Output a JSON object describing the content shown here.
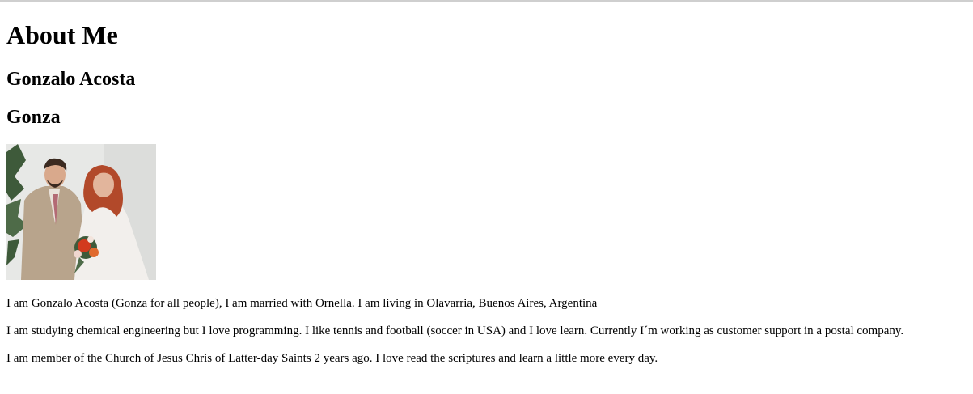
{
  "page": {
    "heading": "About Me",
    "full_name": "Gonzalo Acosta",
    "nickname": "Gonza",
    "photo": {
      "description_icon": "wedding-photo",
      "colors": {
        "background": "#e7e8e6",
        "suit": "#b8a48c",
        "dress": "#f2efec",
        "hair_woman": "#b2492a",
        "hair_man": "#3b2a20",
        "skin": "#d9a98c",
        "flowers": "#d23a1e",
        "leaves": "#3e5a3a"
      }
    },
    "paragraphs": [
      "I am Gonzalo Acosta (Gonza for all people), I am married with Ornella. I am living in Olavarria, Buenos Aires, Argentina",
      "I am studying chemical engineering but I love programming. I like tennis and football (soccer in USA) and I love learn. Currently I´m working as customer support in a postal company.",
      "I am member of the Church of Jesus Chris of Latter-day Saints 2 years ago. I love read the scriptures and learn a little more every day."
    ]
  }
}
